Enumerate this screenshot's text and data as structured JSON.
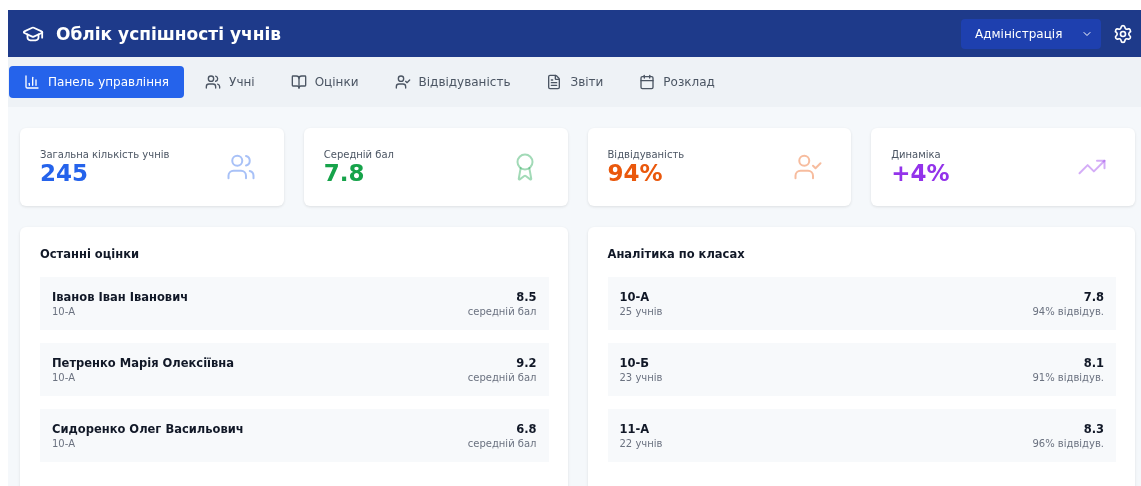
{
  "header": {
    "title": "Облік успішності учнів",
    "role_select": {
      "value": "Адміністрація"
    }
  },
  "tabs": [
    {
      "label": "Панель управління",
      "kind": "chart",
      "selected": true
    },
    {
      "label": "Учні",
      "kind": "users",
      "selected": false
    },
    {
      "label": "Оцінки",
      "kind": "book",
      "selected": false
    },
    {
      "label": "Відвідуваність",
      "kind": "usercheck",
      "selected": false
    },
    {
      "label": "Звіти",
      "kind": "file",
      "selected": false
    },
    {
      "label": "Розклад",
      "kind": "calendar",
      "selected": false
    }
  ],
  "stats": [
    {
      "label": "Загальна кількість учнів",
      "value": "245",
      "kind": "users",
      "color": "#2563eb"
    },
    {
      "label": "Середній бал",
      "value": "7.8",
      "kind": "award",
      "color": "#16a34a"
    },
    {
      "label": "Відвідуваність",
      "value": "94%",
      "kind": "usercheck",
      "color": "#ea580c"
    },
    {
      "label": "Динаміка",
      "value": "+4%",
      "kind": "trend",
      "color": "#9333ea"
    }
  ],
  "recent_grades": {
    "title": "Останні оцінки",
    "items": [
      {
        "name": "Іванов Іван Іванович",
        "class": "10-А",
        "score": "8.5",
        "caption": "середній бал"
      },
      {
        "name": "Петренко Марія Олексіївна",
        "class": "10-А",
        "score": "9.2",
        "caption": "середній бал"
      },
      {
        "name": "Сидоренко Олег Васильович",
        "class": "10-А",
        "score": "6.8",
        "caption": "середній бал"
      }
    ]
  },
  "class_analytics": {
    "title": "Аналітика по класах",
    "items": [
      {
        "name": "10-А",
        "class": "25 учнів",
        "score": "7.8",
        "caption": "94% відвідув."
      },
      {
        "name": "10-Б",
        "class": "23 учнів",
        "score": "8.1",
        "caption": "91% відвідув."
      },
      {
        "name": "11-А",
        "class": "22 учнів",
        "score": "8.3",
        "caption": "96% відвідув."
      }
    ]
  }
}
